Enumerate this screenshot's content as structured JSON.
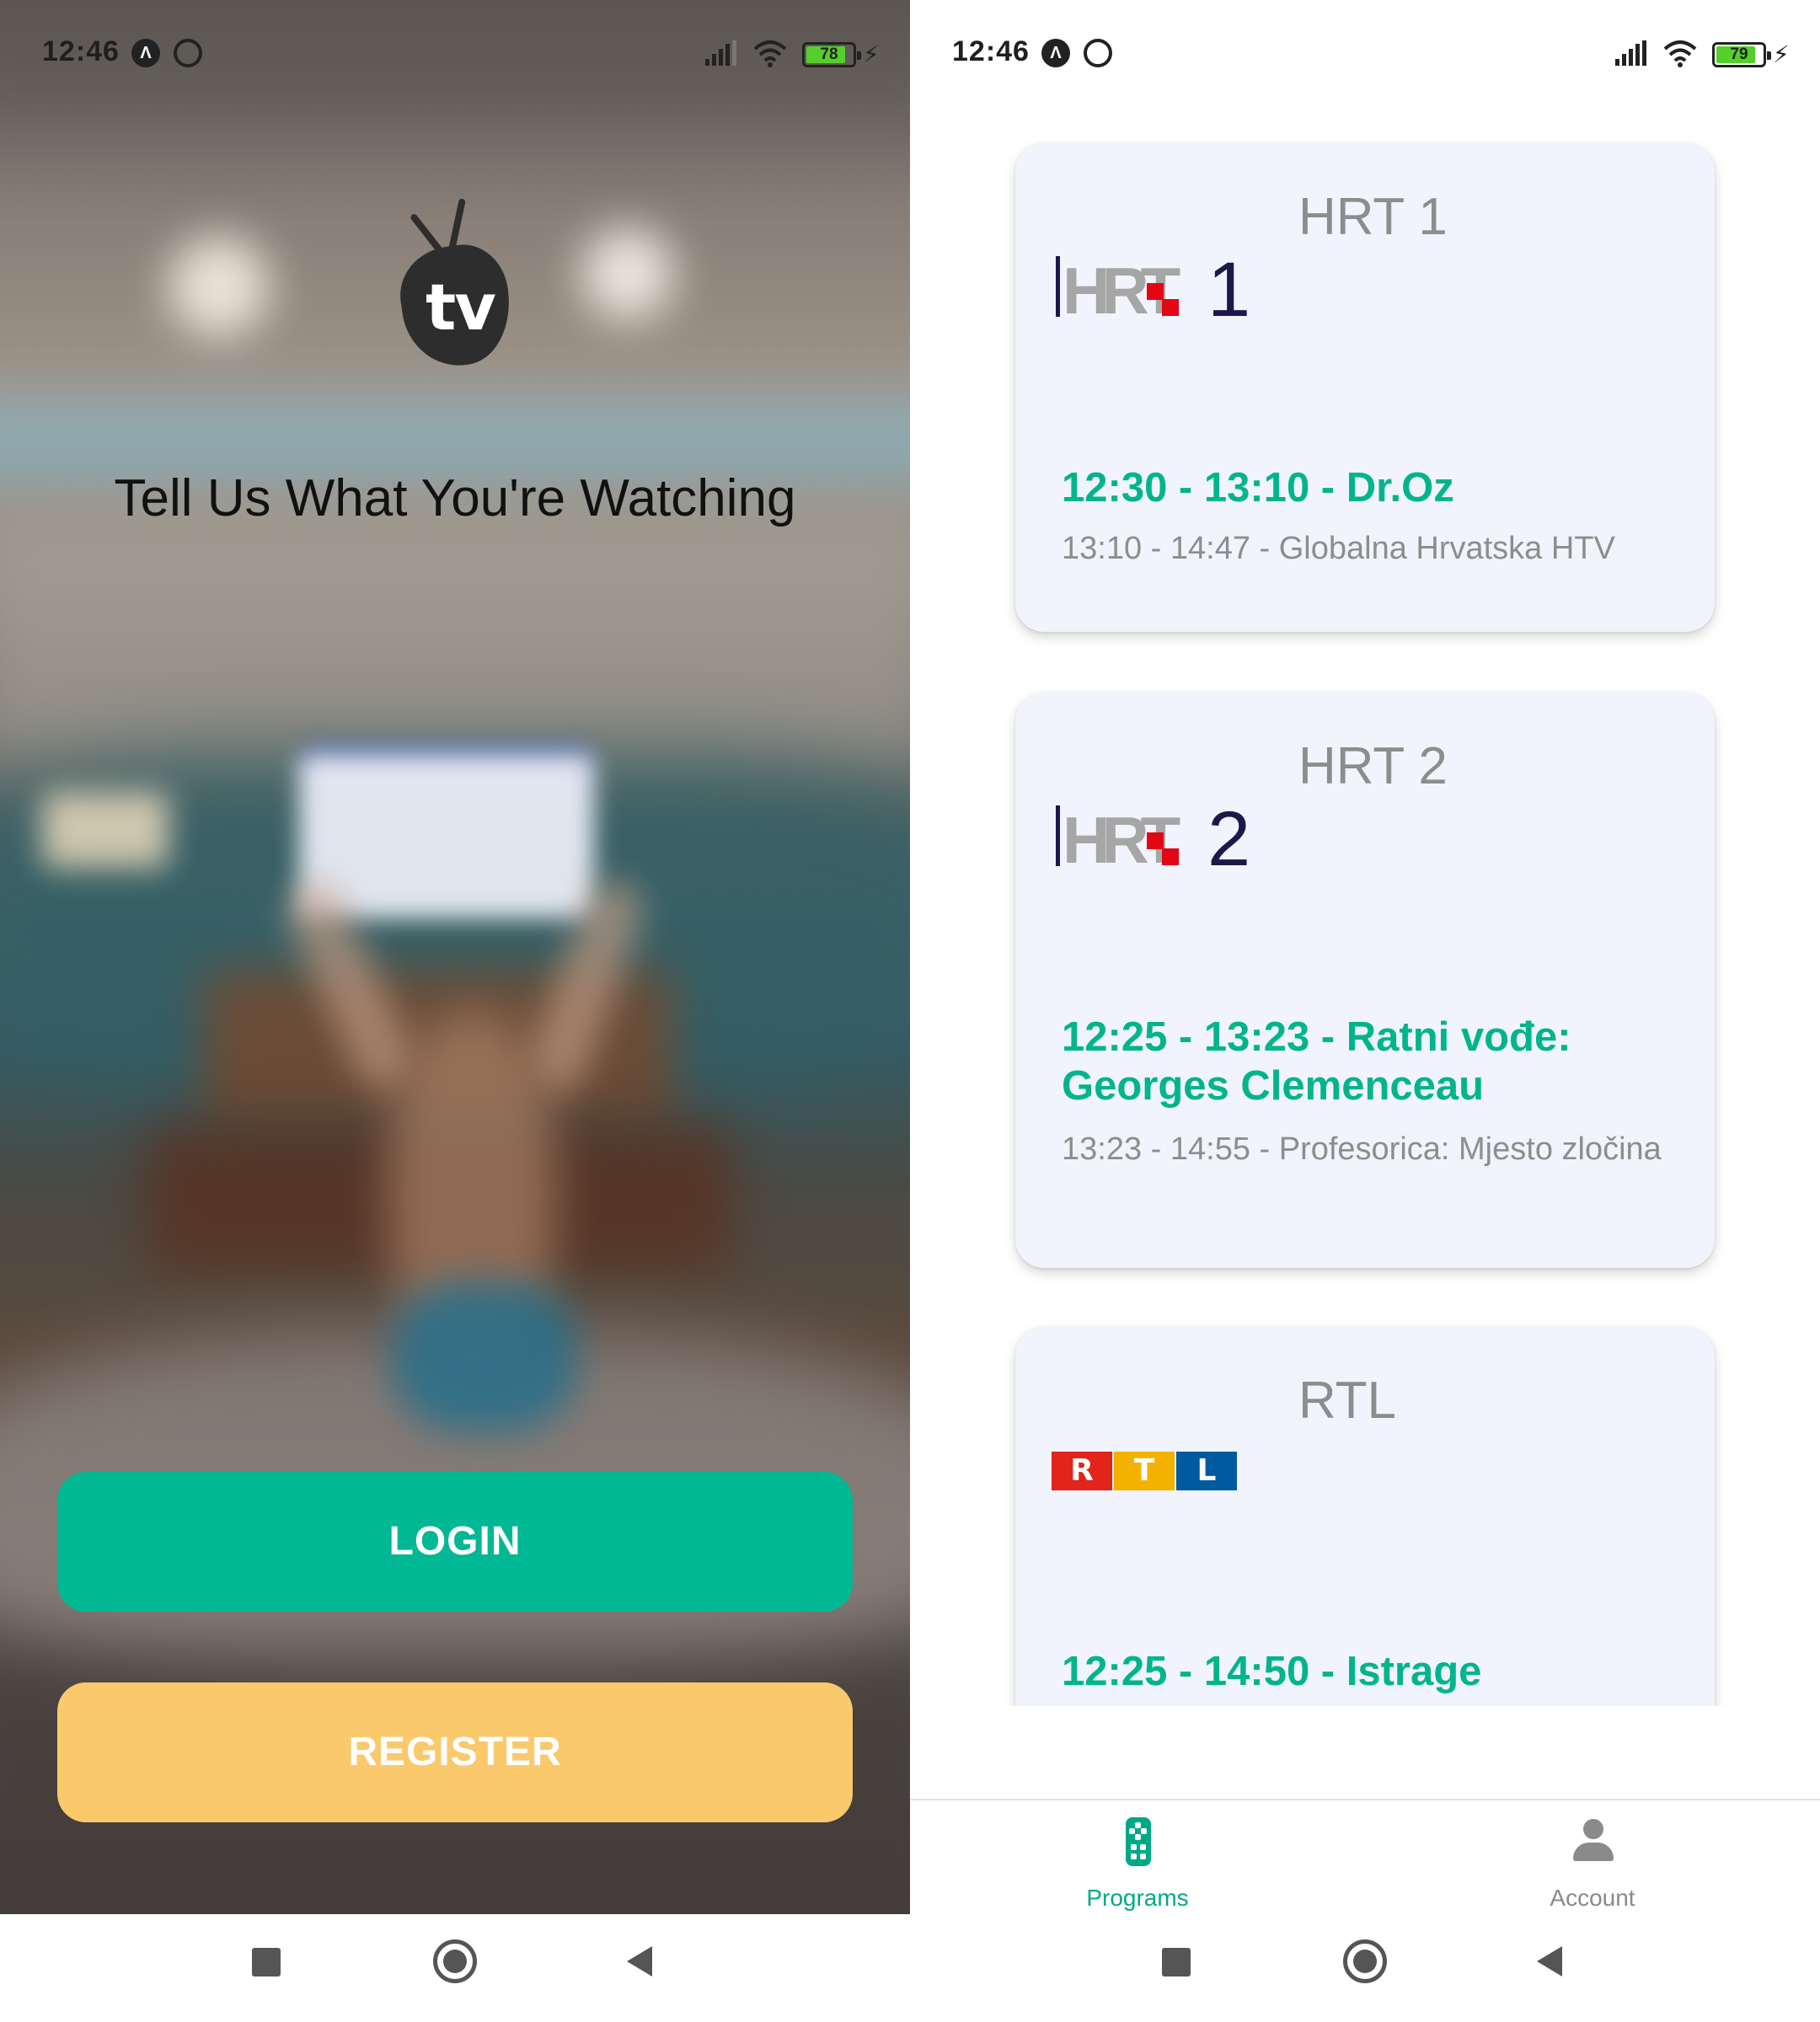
{
  "left_screen": {
    "status_bar": {
      "time": "12:46",
      "battery": "78"
    },
    "logo_text": "tv",
    "tagline": "Tell Us What You're Watching",
    "buttons": {
      "login": "LOGIN",
      "register": "REGISTER"
    },
    "colors": {
      "login": "#00b893",
      "register": "#f9c96c"
    }
  },
  "right_screen": {
    "status_bar": {
      "time": "12:46",
      "battery": "79"
    },
    "channels": [
      {
        "name": "HRT 1",
        "logo": {
          "letters": "HRT",
          "number": "1"
        },
        "now": "12:30 - 13:10 - Dr.Oz",
        "next": "13:10 - 14:47 - Globalna Hrvatska HTV"
      },
      {
        "name": "HRT 2",
        "logo": {
          "letters": "HRT",
          "number": "2"
        },
        "now": "12:25 - 13:23 - Ratni vođe: Georges Clemenceau",
        "next": "13:23 - 14:55 - Profesorica: Mjesto zločina"
      },
      {
        "name": "RTL",
        "logo": {
          "letters": [
            "R",
            "T",
            "L"
          ]
        },
        "now": "12:25 - 14:50 - Istrage",
        "next": ""
      }
    ],
    "tabs": {
      "programs": "Programs",
      "account": "Account"
    },
    "colors": {
      "accent": "#00b48c",
      "card_bg": "#f1f4fc"
    }
  }
}
